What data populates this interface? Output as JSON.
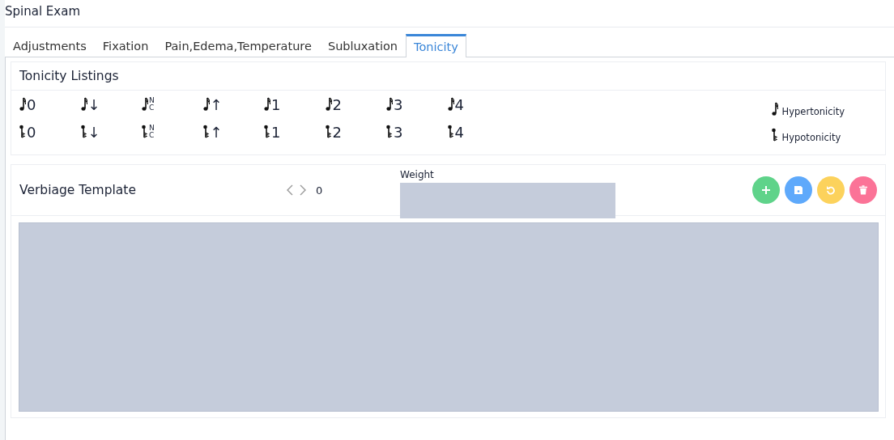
{
  "window": {
    "title": "Spinal Exam"
  },
  "tabs": [
    {
      "label": "Adjustments",
      "selected": false
    },
    {
      "label": "Fixation",
      "selected": false
    },
    {
      "label": "Pain,Edema,Temperature",
      "selected": false
    },
    {
      "label": "Subluxation",
      "selected": false
    },
    {
      "label": "Tonicity",
      "selected": true
    }
  ],
  "listings": {
    "title": "Tonicity Listings",
    "rows": [
      [
        {
          "kind": "hyper",
          "label": "0"
        },
        {
          "kind": "hyper",
          "label": "↓"
        },
        {
          "kind": "hyper",
          "top": "N",
          "bottom": "C"
        },
        {
          "kind": "hyper",
          "label": "↑"
        },
        {
          "kind": "hyper",
          "label": "1"
        },
        {
          "kind": "hyper",
          "label": "2"
        },
        {
          "kind": "hyper",
          "label": "3"
        },
        {
          "kind": "hyper",
          "label": "4"
        }
      ],
      [
        {
          "kind": "hypo",
          "label": "0"
        },
        {
          "kind": "hypo",
          "label": "↓"
        },
        {
          "kind": "hypo",
          "top": "N",
          "bottom": "C"
        },
        {
          "kind": "hypo",
          "label": "↑"
        },
        {
          "kind": "hypo",
          "label": "1"
        },
        {
          "kind": "hypo",
          "label": "2"
        },
        {
          "kind": "hypo",
          "label": "3"
        },
        {
          "kind": "hypo",
          "label": "4"
        }
      ]
    ],
    "legend": [
      {
        "kind": "hyper",
        "label": "Hypertonicity"
      },
      {
        "kind": "hypo",
        "label": "Hypotonicity"
      }
    ]
  },
  "verbiage": {
    "title": "Verbiage Template",
    "counter": "0",
    "weight_label": "Weight",
    "actions": [
      {
        "kind": "add",
        "color": "#5fd38a"
      },
      {
        "kind": "save",
        "color": "#5ea9fb"
      },
      {
        "kind": "reset",
        "color": "#fcd25c"
      },
      {
        "kind": "delete",
        "color": "#fb7397"
      }
    ]
  }
}
